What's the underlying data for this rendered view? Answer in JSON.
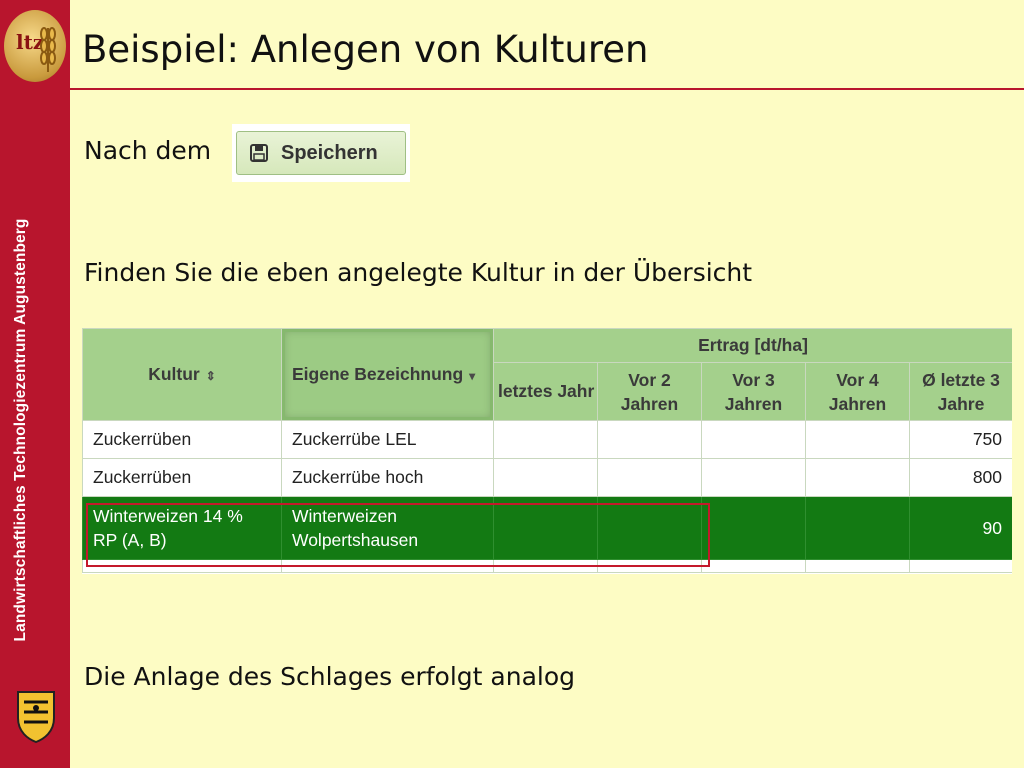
{
  "sidebar": {
    "logo_text": "ltz",
    "vertical_text": "Landwirtschaftliches Technologiezentrum Augustenberg"
  },
  "slide": {
    "title": "Beispiel: Anlegen von Kulturen",
    "line1": "Nach dem",
    "save_button_label": "Speichern",
    "line2": "Finden Sie die eben angelegte Kultur in der Übersicht",
    "line3": "Die Anlage des Schlages erfolgt analog"
  },
  "grid": {
    "headers": {
      "kultur": "Kultur",
      "bezeichnung": "Eigene Bezeichnung",
      "ertrag_group": "Ertrag [dt/ha]",
      "letztes_jahr": "letztes Jahr",
      "vor2": "Vor 2 Jahren",
      "vor3": "Vor 3 Jahren",
      "vor4": "Vor 4 Jahren",
      "avg3": "Ø letzte 3 Jahre"
    },
    "rows": [
      {
        "kultur": "Zuckerrüben",
        "bezeichnung": "Zuckerrübe LEL",
        "letztes_jahr": "",
        "vor2": "",
        "vor3": "",
        "vor4": "",
        "avg3": "750"
      },
      {
        "kultur": "Zuckerrüben",
        "bezeichnung": "Zuckerrübe hoch",
        "letztes_jahr": "",
        "vor2": "",
        "vor3": "",
        "vor4": "",
        "avg3": "800"
      },
      {
        "kultur": "Winterweizen 14 % RP (A, B)",
        "bezeichnung": "Winterweizen Wolpertshausen",
        "letztes_jahr": "",
        "vor2": "",
        "vor3": "",
        "vor4": "",
        "avg3": "90"
      }
    ]
  },
  "colors": {
    "background": "#fdfcc4",
    "sidebar": "#b8152d",
    "header_green": "#a4d08c",
    "selected_row": "#137a13",
    "highlight_box": "#c4192b"
  }
}
